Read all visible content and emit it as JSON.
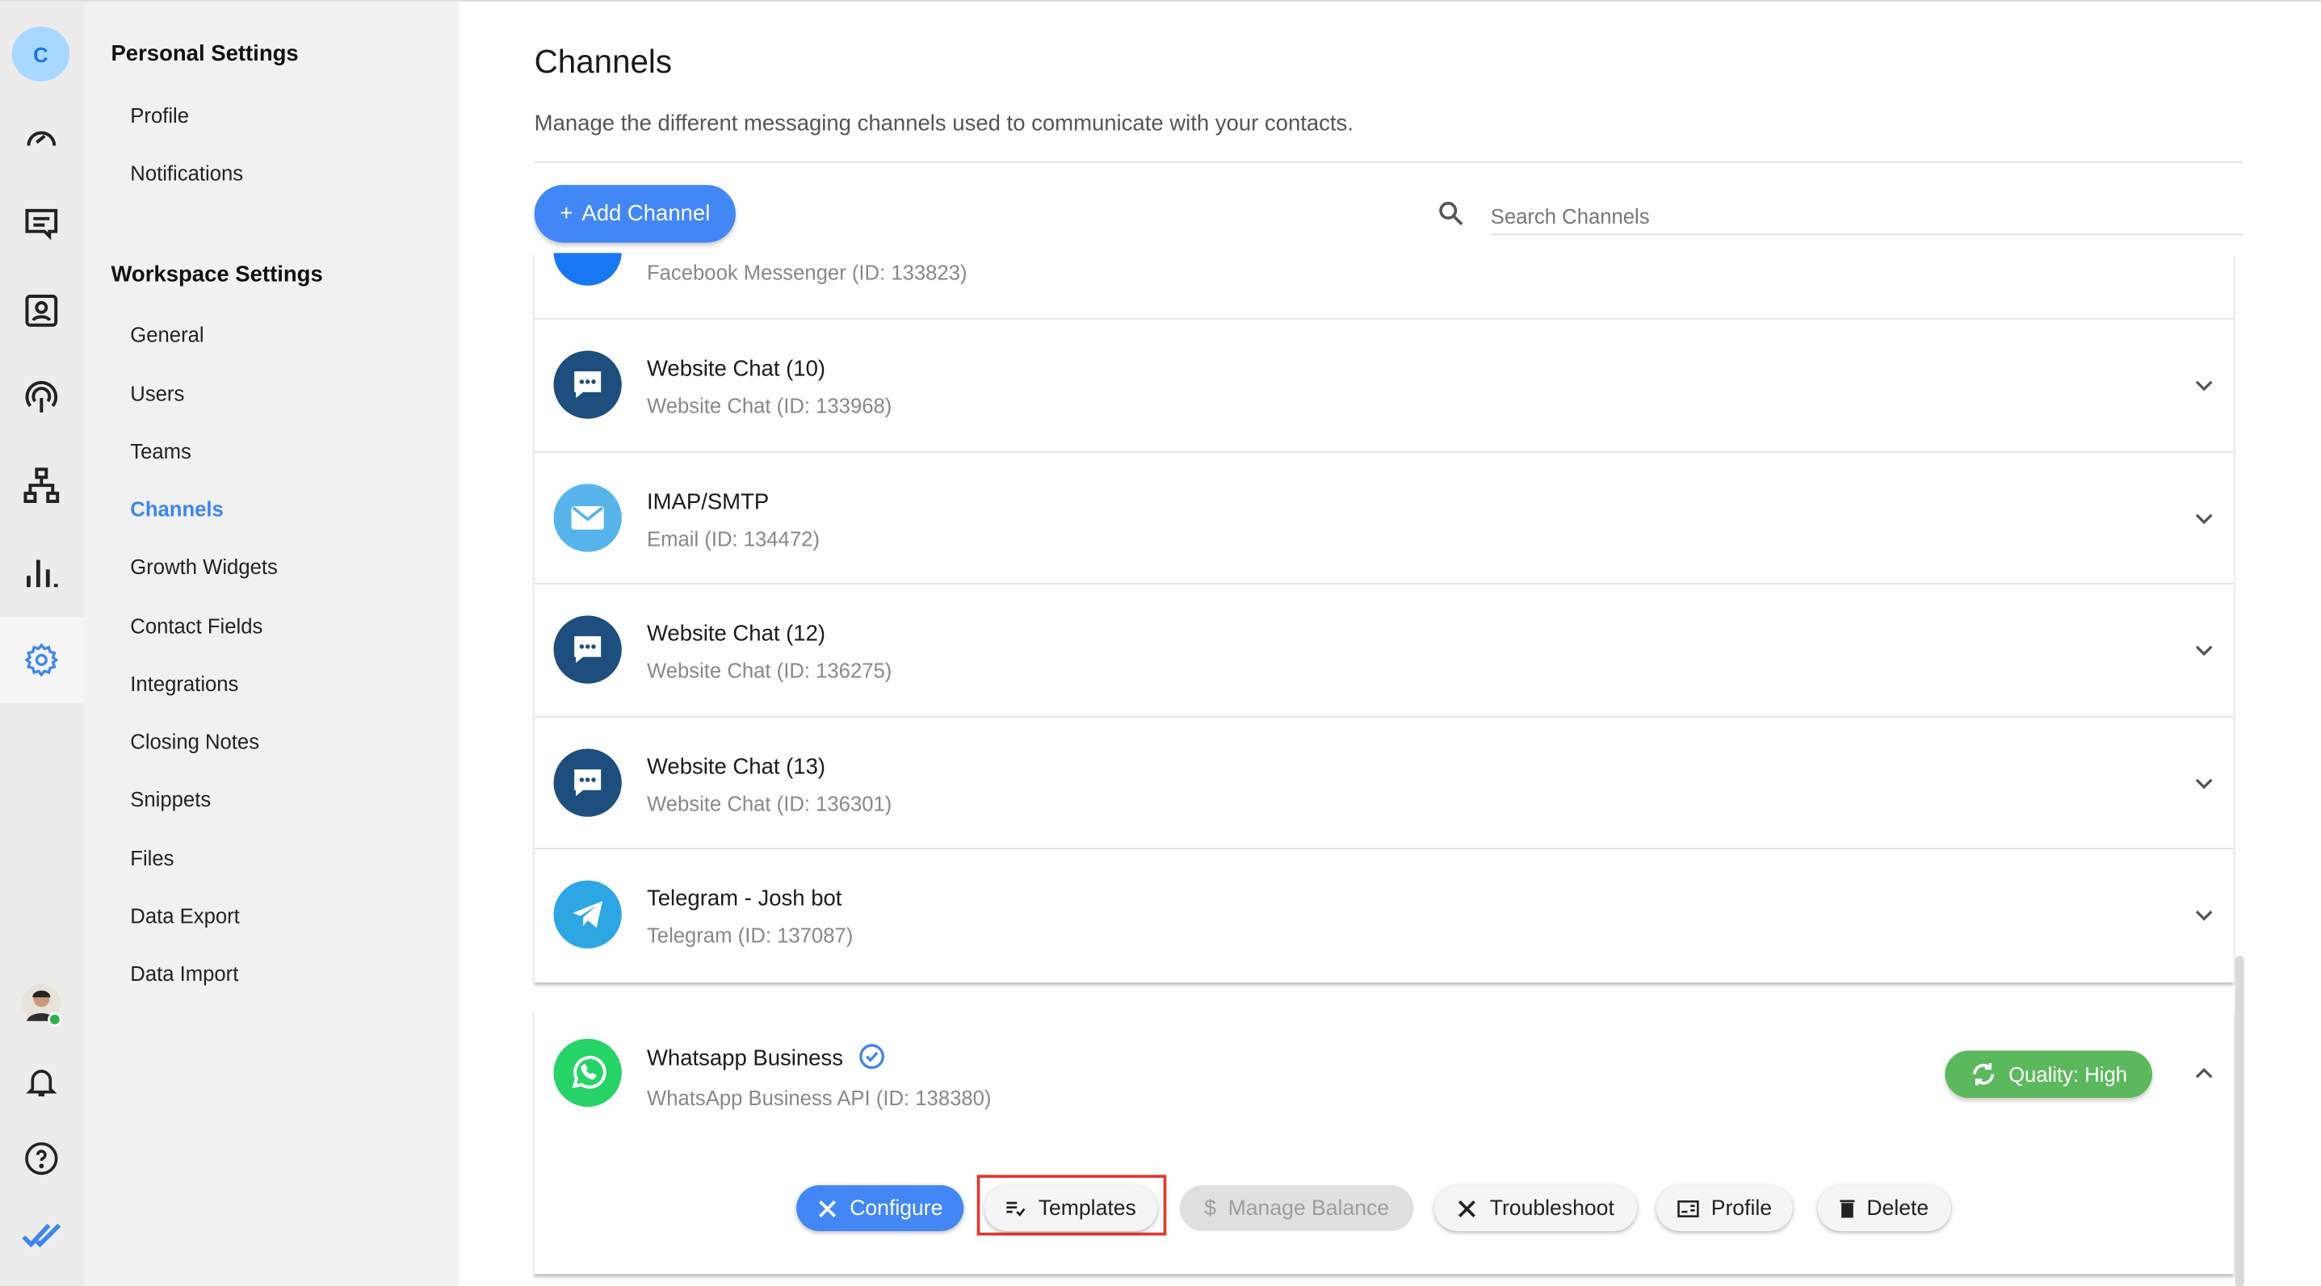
{
  "rail": {
    "avatar_letter": "C",
    "icons": [
      "dashboard-icon",
      "conversations-icon",
      "contacts-icon",
      "broadcast-icon",
      "workflows-icon",
      "reports-icon",
      "settings-icon"
    ],
    "bottom_icons": [
      "user-avatar",
      "bell-icon",
      "help-icon",
      "logo-icon"
    ],
    "active_color": "#3d86f0"
  },
  "sidebar": {
    "personal_title": "Personal Settings",
    "personal_items": [
      "Profile",
      "Notifications"
    ],
    "workspace_title": "Workspace Settings",
    "workspace_items": [
      "General",
      "Users",
      "Teams",
      "Channels",
      "Growth Widgets",
      "Contact Fields",
      "Integrations",
      "Closing Notes",
      "Snippets",
      "Files",
      "Data Export",
      "Data Import"
    ],
    "active_item": "Channels"
  },
  "header": {
    "title": "Channels",
    "description": "Manage the different messaging channels used to communicate with your contacts."
  },
  "toolbar": {
    "add_label": "Add Channel",
    "search_placeholder": "Search Channels",
    "search_value": ""
  },
  "channels": [
    {
      "name": "",
      "sub": "Facebook Messenger (ID: 133823)",
      "icon": "messenger-icon",
      "color": "#1877f2"
    },
    {
      "name": "Website Chat (10)",
      "sub": "Website Chat (ID: 133968)",
      "icon": "chat-bubble-icon",
      "color": "#1d4e7e"
    },
    {
      "name": "IMAP/SMTP",
      "sub": "Email (ID: 134472)",
      "icon": "email-icon",
      "color": "#56b4ea"
    },
    {
      "name": "Website Chat (12)",
      "sub": "Website Chat (ID: 136275)",
      "icon": "chat-bubble-icon",
      "color": "#1d4e7e"
    },
    {
      "name": "Website Chat (13)",
      "sub": "Website Chat (ID: 136301)",
      "icon": "chat-bubble-icon",
      "color": "#1d4e7e"
    },
    {
      "name": "Telegram - Josh bot",
      "sub": "Telegram (ID: 137087)",
      "icon": "telegram-icon",
      "color": "#2ea6e4"
    }
  ],
  "expanded": {
    "name": "Whatsapp Business",
    "sub": "WhatsApp Business API (ID: 138380)",
    "verified": true,
    "color": "#25d366",
    "quality": "Quality: High",
    "quality_color": "#5cb85c",
    "actions": {
      "configure": "Configure",
      "templates": "Templates",
      "manage_balance": "Manage Balance",
      "troubleshoot": "Troubleshoot",
      "profile": "Profile",
      "delete": "Delete"
    },
    "highlighted_action": "Templates"
  }
}
